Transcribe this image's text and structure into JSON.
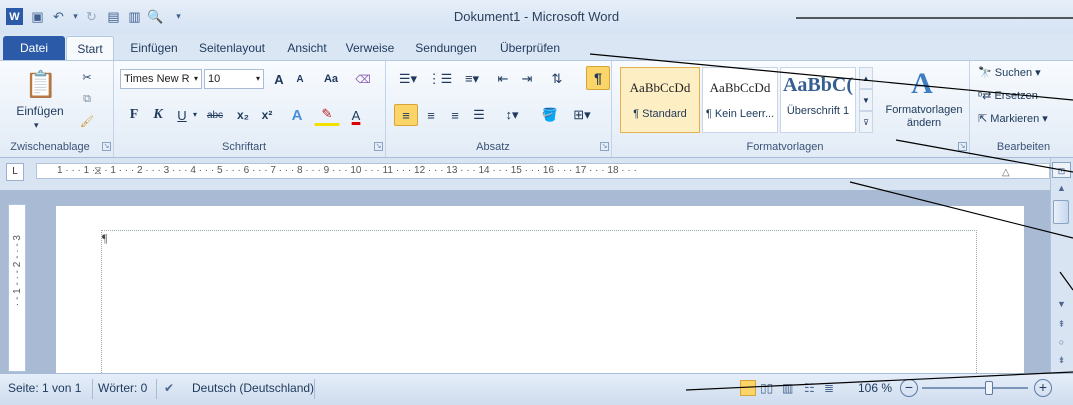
{
  "window": {
    "title": "Dokument1 - Microsoft Word"
  },
  "qat": {
    "word_icon": "word-app-icon",
    "save_icon": "save-icon",
    "undo_icon": "undo-icon",
    "redo_icon": "redo-icon",
    "new_icon": "new-document-icon",
    "print_preview_icon": "print-preview-icon",
    "customize_icon": "customize-dropdown-icon"
  },
  "tabs": [
    {
      "label": "Datei"
    },
    {
      "label": "Start"
    },
    {
      "label": "Einfügen"
    },
    {
      "label": "Seitenlayout"
    },
    {
      "label": "Ansicht"
    },
    {
      "label": "Verweise"
    },
    {
      "label": "Sendungen"
    },
    {
      "label": "Überprüfen"
    }
  ],
  "ribbon": {
    "clipboard": {
      "paste_label": "Einfügen",
      "group_label": "Zwischenablage"
    },
    "font": {
      "font_name": "Times New R",
      "font_size": "10",
      "group_label": "Schriftart",
      "grow": "A",
      "shrink": "A",
      "case": "Aa",
      "bold": "F",
      "italic": "K",
      "underline": "U",
      "strike": "abc",
      "sub": "x₂",
      "sup": "x²",
      "highlight": "A",
      "color": "A"
    },
    "paragraph": {
      "group_label": "Absatz",
      "show_marks": "¶"
    },
    "styles": {
      "group_label": "Formatvorlagen",
      "tiles": [
        {
          "preview": "AaBbCcDd",
          "name": "¶ Standard"
        },
        {
          "preview": "AaBbCcDd",
          "name": "¶ Kein Leerr..."
        },
        {
          "preview": "AaBbC(",
          "name": "Überschrift 1"
        }
      ],
      "change_label": "Formatvorlagen ändern"
    },
    "editing": {
      "group_label": "Bearbeiten",
      "find": "Suchen",
      "replace": "Ersetzen",
      "select": "Markieren"
    }
  },
  "ruler": {
    "text": "1 · · · 1 · · · 1 · · · 2 · · · 3 · · · 4 · · · 5 · · · 6 · · · 7 · · · 8 · · · 9 · · · 10 · · · 11 · · · 12 · · · 13 · · · 14 · · · 15 · · · 16 · · · 17 · · · 18 · · ·",
    "tab_selector": "L"
  },
  "vruler": {
    "text": "· - 1 - · - 2 - · - 3"
  },
  "document": {
    "paragraph_mark": "¶"
  },
  "status": {
    "page": "Seite: 1 von 1",
    "words": "Wörter: 0",
    "language": "Deutsch (Deutschland)",
    "zoom": "106 %",
    "zoom_minus": "−",
    "zoom_plus": "+"
  }
}
